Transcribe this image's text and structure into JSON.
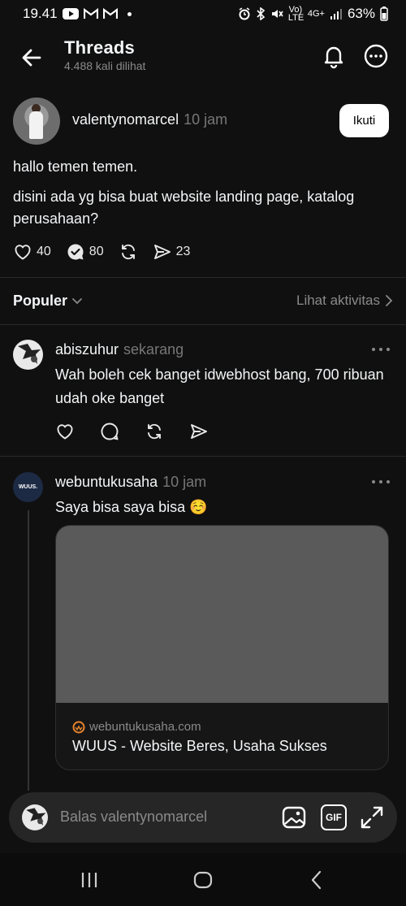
{
  "status": {
    "time": "19.41",
    "battery": "63%",
    "network": "4G+",
    "volte": "Vo) LTE"
  },
  "header": {
    "title": "Threads",
    "views": "4.488 kali dilihat"
  },
  "post": {
    "username": "valentynomarcel",
    "time": "10 jam",
    "follow_label": "Ikuti",
    "paragraphs": [
      "hallo temen temen.",
      "disini ada yg bisa buat website landing page, katalog perusahaan?"
    ],
    "likes": "40",
    "replies": "80",
    "shares": "23"
  },
  "sort": {
    "label": "Populer",
    "activity_label": "Lihat aktivitas"
  },
  "replies": [
    {
      "username": "abiszuhur",
      "time": "sekarang",
      "text": "Wah boleh cek banget  idwebhost bang, 700 ribuan udah oke banget"
    },
    {
      "username": "webuntukusaha",
      "time": "10 jam",
      "text": "Saya bisa saya bisa ☺️",
      "avatar_text": "WUUS.",
      "link": {
        "domain": "webuntukusaha.com",
        "title": "WUUS - Website Beres, Usaha Sukses"
      }
    }
  ],
  "reply_bar": {
    "placeholder": "Balas valentynomarcel",
    "gif_label": "GIF"
  },
  "colors": {
    "background": "#101010",
    "text": "#f3f5f7",
    "muted": "#8a8a8a",
    "link_preview": "#5a5a5a",
    "reply_bar": "#262626"
  },
  "icons": [
    "back-arrow-icon",
    "bell-icon",
    "more-icon",
    "heart-icon",
    "comment-icon",
    "repost-icon",
    "share-icon",
    "chevron-down-icon",
    "chevron-right-icon",
    "image-icon",
    "gif-icon",
    "expand-icon"
  ]
}
